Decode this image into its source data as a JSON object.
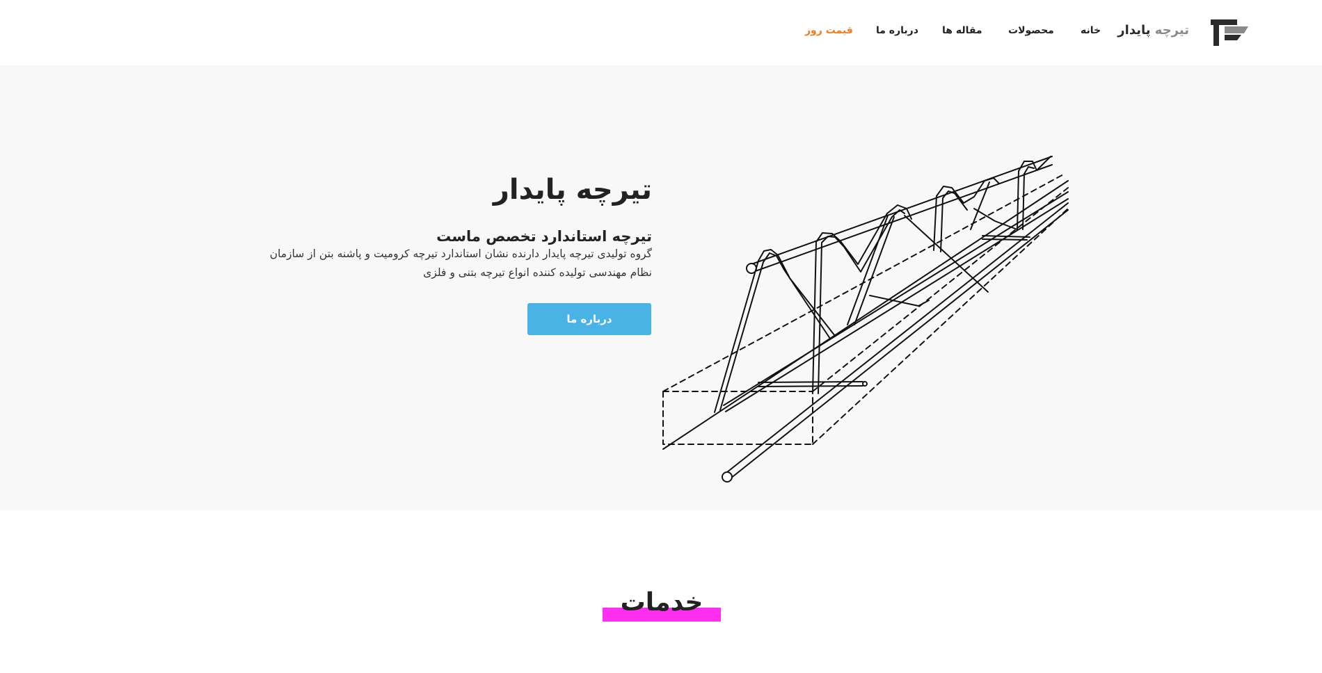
{
  "header": {
    "brand_part1": "تیرچه",
    "brand_part2": "پایدار",
    "nav": {
      "home": "خانه",
      "products": "محصولات",
      "articles": "مقاله ها",
      "about": "درباره ما",
      "daily_price": "قیمت روز"
    }
  },
  "hero": {
    "title": "تیرچه پایدار",
    "subtitle": "تیرچه استاندارد تخصص ماست",
    "description": "گروه تولیدی تیرچه پایدار دارنده نشان استاندارد تیرچه کرومیت و پاشنه بتن از سازمان نظام مهندسی تولیده کننده انواع تیرچه بتنی و فلزی",
    "button_label": "درباره ما"
  },
  "services": {
    "title": "خدمات"
  },
  "colors": {
    "accent_nav": "#f07c1b",
    "button": "#4ab3e6",
    "highlight": "#ff2ef1",
    "hero_bg": "#f8f8f8"
  },
  "icons": {
    "logo": "company-logo-icon",
    "illustration": "truss-illustration"
  }
}
